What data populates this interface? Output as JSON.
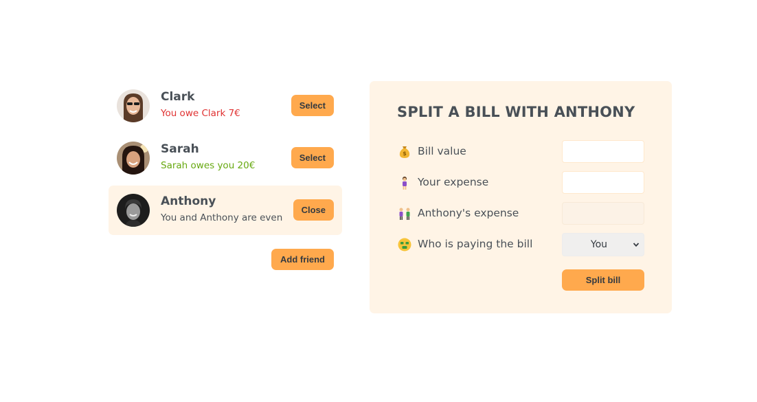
{
  "friends": [
    {
      "name": "Clark",
      "status": "You owe Clark 7€",
      "button": "Select"
    },
    {
      "name": "Sarah",
      "status": "Sarah owes you 20€",
      "button": "Select"
    },
    {
      "name": "Anthony",
      "status": "You and Anthony are even",
      "button": "Close"
    }
  ],
  "add_friend_label": "Add friend",
  "form": {
    "title": "SPLIT A BILL WITH ANTHONY",
    "bill_value_label": "Bill value",
    "your_expense_label": "Your expense",
    "friend_expense_label": "Anthony's expense",
    "who_pays_label": "Who is paying the bill",
    "who_pays_value": "You",
    "submit_label": "Split bill"
  },
  "colors": {
    "accent": "#ffa94d",
    "panel": "#fff4e6",
    "owe_red": "#e03131",
    "owed_green": "#66a80f"
  },
  "icons": {
    "bill_value": "money-bag-icon",
    "your_expense": "person-icon",
    "friend_expense": "two-people-icon",
    "who_pays": "money-mouth-face-icon"
  }
}
